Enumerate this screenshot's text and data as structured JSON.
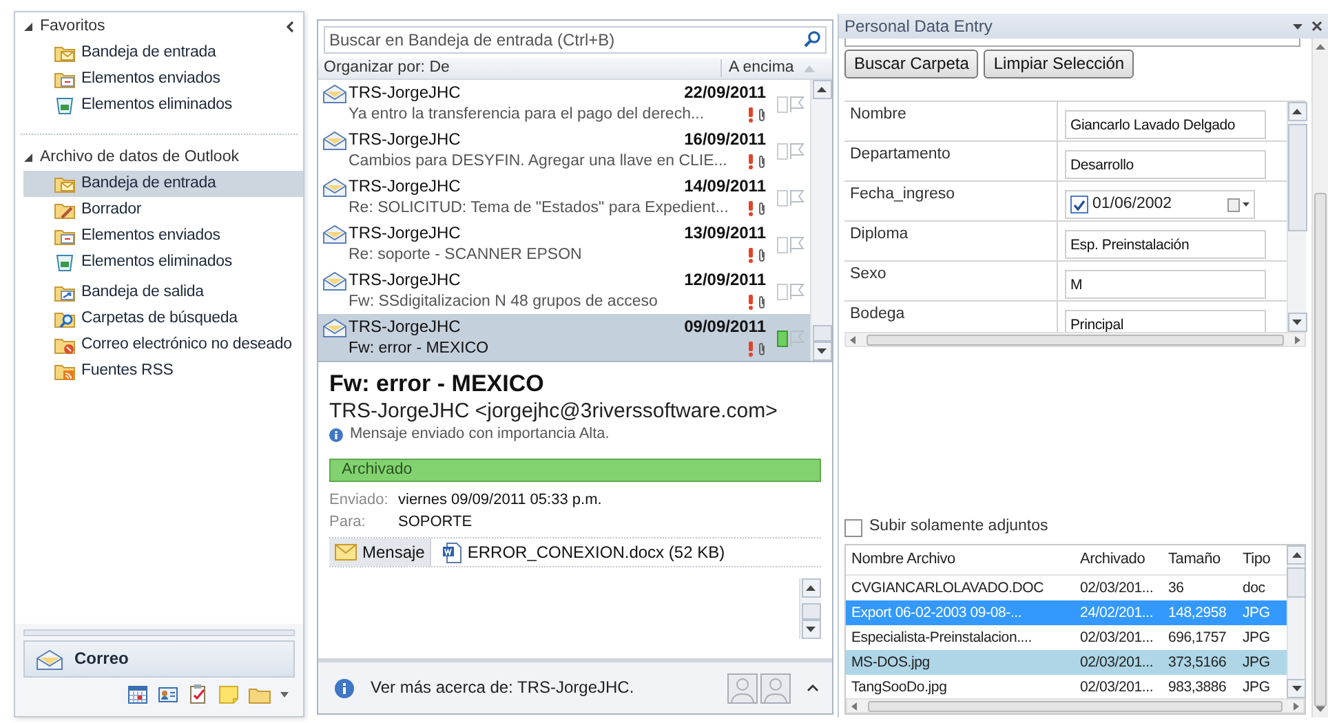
{
  "nav": {
    "sections": [
      {
        "label": "Favoritos",
        "expanded": true,
        "groups": [
          [
            {
              "label": "Bandeja de entrada",
              "kind": "inbox",
              "selected": false
            },
            {
              "label": "Elementos enviados",
              "kind": "sent",
              "selected": false
            },
            {
              "label": "Elementos eliminados",
              "kind": "deleted",
              "selected": false
            }
          ]
        ]
      },
      {
        "label": "Archivo de datos de Outlook",
        "expanded": true,
        "groups": [
          [
            {
              "label": "Bandeja de entrada",
              "kind": "inbox",
              "selected": true
            },
            {
              "label": "Borrador",
              "kind": "drafts",
              "selected": false
            },
            {
              "label": "Elementos enviados",
              "kind": "sent",
              "selected": false
            },
            {
              "label": "Elementos eliminados",
              "kind": "deleted",
              "selected": false
            }
          ],
          [
            {
              "label": "Bandeja de salida",
              "kind": "outbox",
              "selected": false
            },
            {
              "label": "Carpetas de búsqueda",
              "kind": "search",
              "selected": false
            },
            {
              "label": "Correo electrónico no deseado",
              "kind": "junk",
              "selected": false
            },
            {
              "label": "Fuentes RSS",
              "kind": "rss",
              "selected": false
            }
          ]
        ]
      }
    ],
    "module_button": {
      "label": "Correo",
      "selected": true
    }
  },
  "mail_list": {
    "search_placeholder": "Buscar en Bandeja de entrada (Ctrl+B)",
    "sort_label": "Organizar por: De",
    "order_label": "A encima",
    "messages": [
      {
        "sender": "TRS-JorgeJHC",
        "date": "22/09/2011",
        "subject": "Ya entro la transferencia para el pago del derech...",
        "selected": false,
        "categorized": false
      },
      {
        "sender": "TRS-JorgeJHC",
        "date": "16/09/2011",
        "subject": "Cambios para DESYFIN.  Agregar una llave en CLIE...",
        "selected": false,
        "categorized": false
      },
      {
        "sender": "TRS-JorgeJHC",
        "date": "14/09/2011",
        "subject": "Re: SOLICITUD: Tema de \"Estados\" para Expedient...",
        "selected": false,
        "categorized": false
      },
      {
        "sender": "TRS-JorgeJHC",
        "date": "13/09/2011",
        "subject": "Re: soporte - SCANNER EPSON",
        "selected": false,
        "categorized": false
      },
      {
        "sender": "TRS-JorgeJHC",
        "date": "12/09/2011",
        "subject": "Fw: SSdigitalizacion N 48 grupos de acceso",
        "selected": false,
        "categorized": false
      },
      {
        "sender": "TRS-JorgeJHC",
        "date": "09/09/2011",
        "subject": "Fw: error - MEXICO",
        "selected": true,
        "categorized": true
      }
    ]
  },
  "reading": {
    "subject": "Fw: error - MEXICO",
    "from": "TRS-JorgeJHC <jorgejhc@3riverssoftware.com>",
    "notice": "Mensaje enviado con importancia Alta.",
    "category": "Archivado",
    "headers": [
      {
        "label": "Enviado:",
        "value": "viernes 09/09/2011 05:33 p.m."
      },
      {
        "label": "Para:",
        "value": "SOPORTE"
      }
    ],
    "tabs": [
      {
        "label": "Mensaje",
        "kind": "message",
        "selected": true
      },
      {
        "label": "ERROR_CONEXION.docx (52 KB)",
        "kind": "word",
        "selected": false
      }
    ],
    "people_pane": "Ver más acerca de: TRS-JorgeJHC."
  },
  "panel": {
    "title": "Personal Data Entry",
    "buttons": [
      "Buscar Carpeta",
      "Limpiar Selección"
    ],
    "fields": [
      {
        "label": "Nombre",
        "kind": "text",
        "value": "Giancarlo Lavado Delgado"
      },
      {
        "label": "Departamento",
        "kind": "text",
        "value": "Desarrollo"
      },
      {
        "label": "Fecha_ingreso",
        "kind": "date",
        "value": "01/06/2002",
        "checked": true
      },
      {
        "label": "Diploma",
        "kind": "text",
        "value": "Esp. Preinstalación"
      },
      {
        "label": "Sexo",
        "kind": "text",
        "value": "M"
      },
      {
        "label": "Bodega",
        "kind": "text",
        "value": "Principal"
      }
    ],
    "attachments_only": {
      "label": "Subir solamente adjuntos",
      "checked": false
    },
    "files": {
      "columns": [
        "Nombre Archivo",
        "Archivado",
        "Tamaño",
        "Tipo"
      ],
      "rows": [
        {
          "cells": [
            "CVGIANCARLOLAVADO.DOC",
            "02/03/201...",
            "36",
            "doc"
          ],
          "selected": false,
          "highlighted": false
        },
        {
          "cells": [
            "Export 06-02-2003 09-08-...",
            "24/02/201...",
            "148,2958",
            "JPG"
          ],
          "selected": true,
          "highlighted": false
        },
        {
          "cells": [
            "Especialista-Preinstalacion....",
            "02/03/201...",
            "696,1757",
            "JPG"
          ],
          "selected": false,
          "highlighted": false
        },
        {
          "cells": [
            "MS-DOS.jpg",
            "02/03/201...",
            "373,5166",
            "JPG"
          ],
          "selected": false,
          "highlighted": true
        },
        {
          "cells": [
            "TangSooDo.jpg",
            "02/03/201...",
            "983,3886",
            "JPG"
          ],
          "selected": false,
          "highlighted": false
        }
      ]
    }
  }
}
